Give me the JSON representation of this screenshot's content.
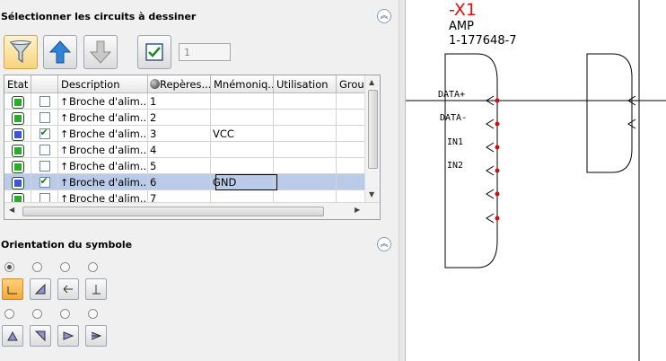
{
  "circuits_panel": {
    "title": "Sélectionner les circuits à dessiner",
    "counter_value": "1",
    "columns": [
      "Etat",
      "",
      "Description",
      "Repères...",
      "Mnémoniq...",
      "Utilisation",
      "Group"
    ],
    "rows": [
      {
        "state_color": "#2fa82f",
        "checked": false,
        "description": "Broche d'alim...",
        "repere": "1",
        "mnemo": "",
        "selected": false
      },
      {
        "state_color": "#2fa82f",
        "checked": false,
        "description": "Broche d'alim...",
        "repere": "2",
        "mnemo": "",
        "selected": false
      },
      {
        "state_color": "#3a56d6",
        "checked": true,
        "description": "Broche d'alim...",
        "repere": "3",
        "mnemo": "VCC",
        "selected": false
      },
      {
        "state_color": "#2fa82f",
        "checked": false,
        "description": "Broche d'alim...",
        "repere": "4",
        "mnemo": "",
        "selected": false
      },
      {
        "state_color": "#2fa82f",
        "checked": false,
        "description": "Broche d'alim...",
        "repere": "5",
        "mnemo": "",
        "selected": false
      },
      {
        "state_color": "#3a56d6",
        "checked": true,
        "description": "Broche d'alim...",
        "repere": "6",
        "mnemo": "GND",
        "selected": true
      },
      {
        "state_color": "#2fa82f",
        "checked": false,
        "description": "Broche d'alim...",
        "repere": "7",
        "mnemo": "",
        "selected": false
      }
    ]
  },
  "orientation_panel": {
    "title": "Orientation du symbole",
    "selected_index": 0
  },
  "schematic": {
    "ref": "-X1",
    "type": "AMP",
    "part": "1-177648-7",
    "pins": [
      "DATA+",
      "DATA-",
      "IN1",
      "IN2"
    ],
    "ref_color": "#e01010",
    "pin_dot_color": "#d01010"
  }
}
